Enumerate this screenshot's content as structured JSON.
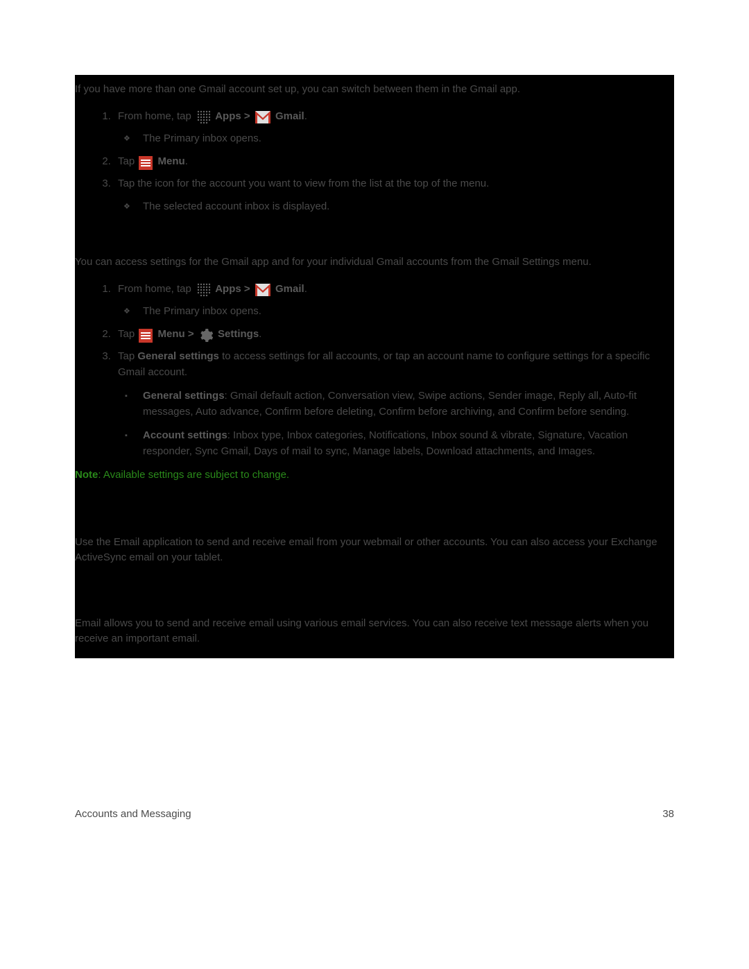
{
  "section1": {
    "intro": "If you have more than one Gmail account set up, you can switch between them in the Gmail app.",
    "step1_prefix": "From home, tap",
    "apps_label": "Apps",
    "gmail_label": "Gmail",
    "step1_sub": "The Primary inbox opens.",
    "step2_prefix": "Tap",
    "menu_label": "Menu",
    "step3": "Tap the icon for the account you want to view from the list at the top of the menu.",
    "step3_sub": "The selected account inbox is displayed."
  },
  "section2": {
    "intro": "You can access settings for the Gmail app and for your individual Gmail accounts from the Gmail Settings menu.",
    "step1_prefix": "From home, tap",
    "apps_label": "Apps",
    "gmail_label": "Gmail",
    "step1_sub": "The Primary inbox opens.",
    "step2_prefix": "Tap",
    "menu_label": "Menu",
    "settings_label": "Settings",
    "step3_prefix": "Tap ",
    "step3_bold": "General settings",
    "step3_suffix": " to access settings for all accounts, or tap an account name to configure settings for a specific Gmail account.",
    "bullet1_bold": "General settings",
    "bullet1_text": ": Gmail default action, Conversation view, Swipe actions, Sender image, Reply all, Auto-fit messages, Auto advance, Confirm before deleting, Confirm before archiving, and Confirm before sending.",
    "bullet2_bold": "Account settings",
    "bullet2_text": ": Inbox type, Inbox categories, Notifications, Inbox sound & vibrate, Signature, Vacation responder, Sync Gmail, Days of mail to sync, Manage labels, Download attachments, and Images.",
    "note_label": "Note",
    "note_text": ": Available settings are subject to change."
  },
  "section3": {
    "intro": "Use the Email application to send and receive email from your webmail or other accounts. You can also access your Exchange ActiveSync email on your tablet."
  },
  "section4": {
    "intro": "Email allows you to send and receive email using various email services. You can also receive text message alerts when you receive an important email."
  },
  "footer": {
    "left": "Accounts and Messaging",
    "right": "38"
  }
}
